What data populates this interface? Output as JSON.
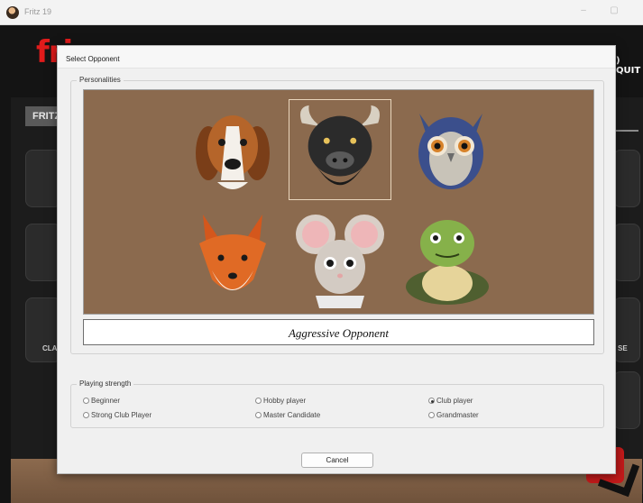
{
  "app": {
    "title": "Fritz 19",
    "logo_text": "fri",
    "quit_label": ") QUIT",
    "tab_label": "FRITZ",
    "tile_label_left": "CLA",
    "tile_label_right": "SE",
    "minimize_glyph": "–",
    "maximize_glyph": "▢"
  },
  "dialog": {
    "title": "Select Opponent",
    "personalities_label": "Personalities",
    "personalities": [
      {
        "name": "beagle",
        "icon": "beagle-icon"
      },
      {
        "name": "bull",
        "icon": "bull-icon",
        "selected": true
      },
      {
        "name": "owl",
        "icon": "owl-icon"
      },
      {
        "name": "fox",
        "icon": "fox-icon"
      },
      {
        "name": "mouse",
        "icon": "mouse-icon"
      },
      {
        "name": "turtle",
        "icon": "turtle-icon"
      }
    ],
    "selected_description": "Aggressive Opponent",
    "strength_label": "Playing strength",
    "strength_options": [
      {
        "label": "Beginner",
        "selected": false
      },
      {
        "label": "Hobby player",
        "selected": false
      },
      {
        "label": "Club player",
        "selected": true
      },
      {
        "label": "Strong Club Player",
        "selected": false
      },
      {
        "label": "Master Candidate",
        "selected": false
      },
      {
        "label": "Grandmaster",
        "selected": false
      }
    ],
    "cancel_label": "Cancel"
  },
  "colors": {
    "panel_brown": "#8b6a4e",
    "logo_red": "#e11b1b",
    "dialog_bg": "#f0f0f0"
  }
}
